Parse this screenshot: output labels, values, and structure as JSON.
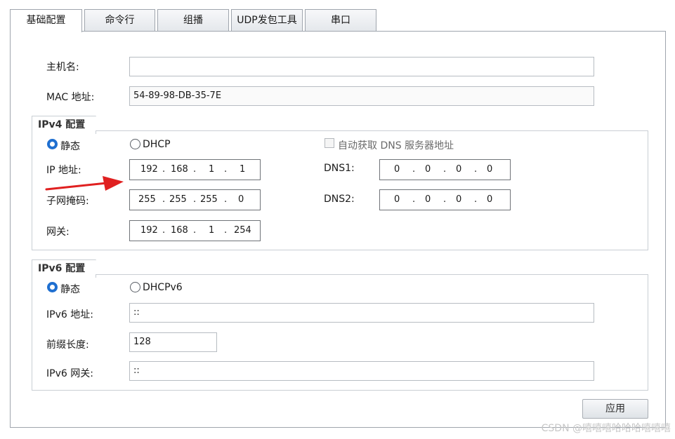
{
  "tabs": [
    "基础配置",
    "命令行",
    "组播",
    "UDP发包工具",
    "串口"
  ],
  "host": {
    "label": "主机名:",
    "value": ""
  },
  "mac": {
    "label": "MAC 地址:",
    "value": "54-89-98-DB-35-7E"
  },
  "ipv4": {
    "title": "IPv4 配置",
    "static_label": "静态",
    "dhcp_label": "DHCP",
    "auto_dns_label": "自动获取 DNS 服务器地址",
    "ip_label": "IP 地址:",
    "ip": [
      "192",
      "168",
      "1",
      "1"
    ],
    "mask_label": "子网掩码:",
    "mask": [
      "255",
      "255",
      "255",
      "0"
    ],
    "gateway_label": "网关:",
    "gateway": [
      "192",
      "168",
      "1",
      "254"
    ],
    "dns1_label": "DNS1:",
    "dns1": [
      "0",
      "0",
      "0",
      "0"
    ],
    "dns2_label": "DNS2:",
    "dns2": [
      "0",
      "0",
      "0",
      "0"
    ],
    "dot": "."
  },
  "ipv6": {
    "title": "IPv6 配置",
    "static_label": "静态",
    "dhcp_label": "DHCPv6",
    "addr_label": "IPv6 地址:",
    "addr": "::",
    "prefix_label": "前缀长度:",
    "prefix": "128",
    "gateway_label": "IPv6 网关:",
    "gateway": "::"
  },
  "apply_label": "应用",
  "watermark": "CSDN @嘻嘻嘻哈哈哈嘻嘻嘻",
  "colors": {
    "arrow": "#e02020",
    "radio_accent": "#1f6fd0"
  }
}
